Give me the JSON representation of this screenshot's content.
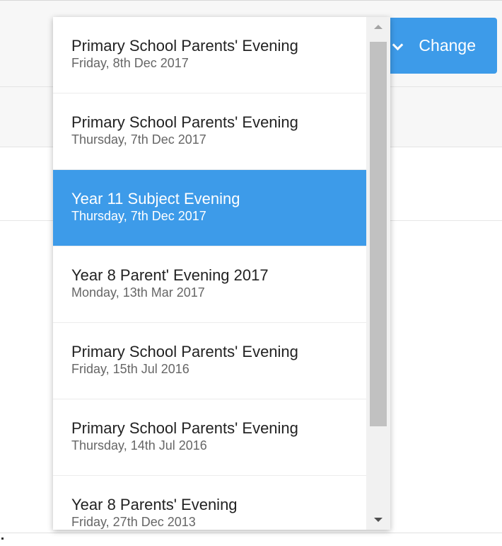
{
  "header": {
    "change_button_label": "Change"
  },
  "dropdown": {
    "selected_index": 2,
    "items": [
      {
        "title": "Primary School Parents' Evening",
        "date": "Friday, 8th Dec 2017"
      },
      {
        "title": "Primary School Parents' Evening",
        "date": "Thursday, 7th Dec 2017"
      },
      {
        "title": "Year 11 Subject Evening",
        "date": "Thursday, 7th Dec 2017"
      },
      {
        "title": "Year 8 Parent' Evening 2017",
        "date": "Monday, 13th Mar 2017"
      },
      {
        "title": "Primary School Parents' Evening",
        "date": "Friday, 15th Jul 2016"
      },
      {
        "title": "Primary School Parents' Evening",
        "date": "Thursday, 14th Jul 2016"
      },
      {
        "title": "Year 8 Parents' Evening",
        "date": "Friday, 27th Dec 2013"
      }
    ]
  },
  "colors": {
    "accent": "#3d9be9"
  }
}
